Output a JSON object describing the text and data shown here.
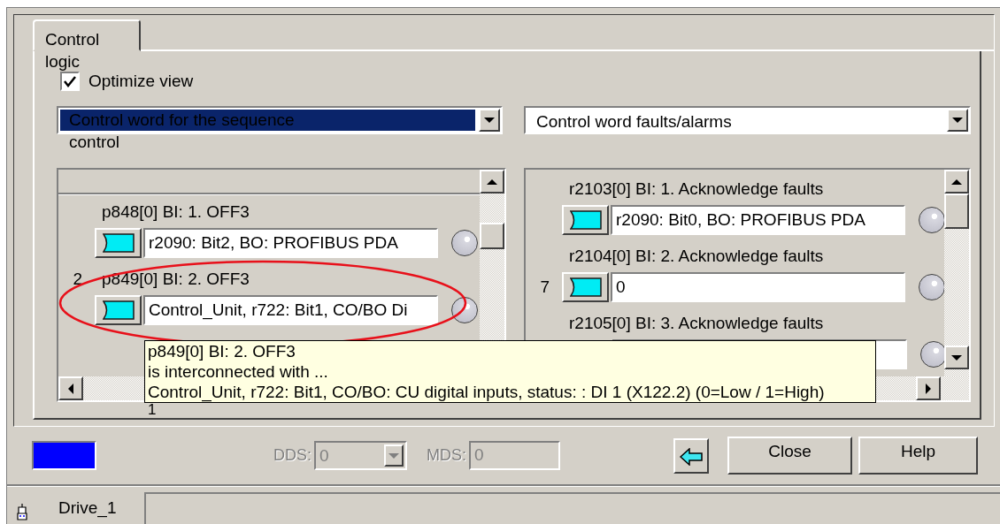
{
  "tabs": [
    {
      "label": "Control logic",
      "selected": true
    }
  ],
  "optimize_view": {
    "label": "Optimize view",
    "checked": true
  },
  "panels": [
    {
      "dropdown": {
        "value": "Control word for the sequence control",
        "focused": true
      },
      "rows": [
        {
          "label": "p848[0] BI: 1. OFF3",
          "value": "r2090: Bit2, BO: PROFIBUS PDA"
        },
        {
          "label": "p849[0] BI: 2. OFF3",
          "value": "Control_Unit, r722: Bit1, CO/BO Di",
          "side_number": "2"
        }
      ]
    },
    {
      "dropdown": {
        "value": "Control word faults/alarms",
        "focused": false
      },
      "rows": [
        {
          "label": "r2103[0] BI: 1. Acknowledge faults",
          "value": "r2090: Bit0, BO: PROFIBUS PDA"
        },
        {
          "label": "r2104[0] BI: 2. Acknowledge faults",
          "value": "0",
          "side_number": "7"
        },
        {
          "label": "r2105[0] BI: 3. Acknowledge faults"
        }
      ]
    }
  ],
  "highlight": {
    "kind": "ellipse"
  },
  "tooltip": {
    "lines": [
      "p849[0] BI: 2. OFF3",
      "is interconnected with ...",
      "Control_Unit, r722: Bit1, CO/BO: CU digital inputs, status: : DI 1 (X122.2) (0=Low / 1=High)"
    ]
  },
  "tooltip_footnote": "1",
  "indicator": {
    "color": "#0000ff"
  },
  "dds": {
    "label": "DDS:",
    "value": "0",
    "disabled": true
  },
  "mds": {
    "label": "MDS:",
    "value": "0",
    "disabled": true
  },
  "buttons": [
    {
      "kind": "back"
    },
    {
      "kind": "text",
      "label": "Close"
    },
    {
      "kind": "text",
      "label": "Help"
    }
  ],
  "status_bar": {
    "device": "Drive_1"
  }
}
